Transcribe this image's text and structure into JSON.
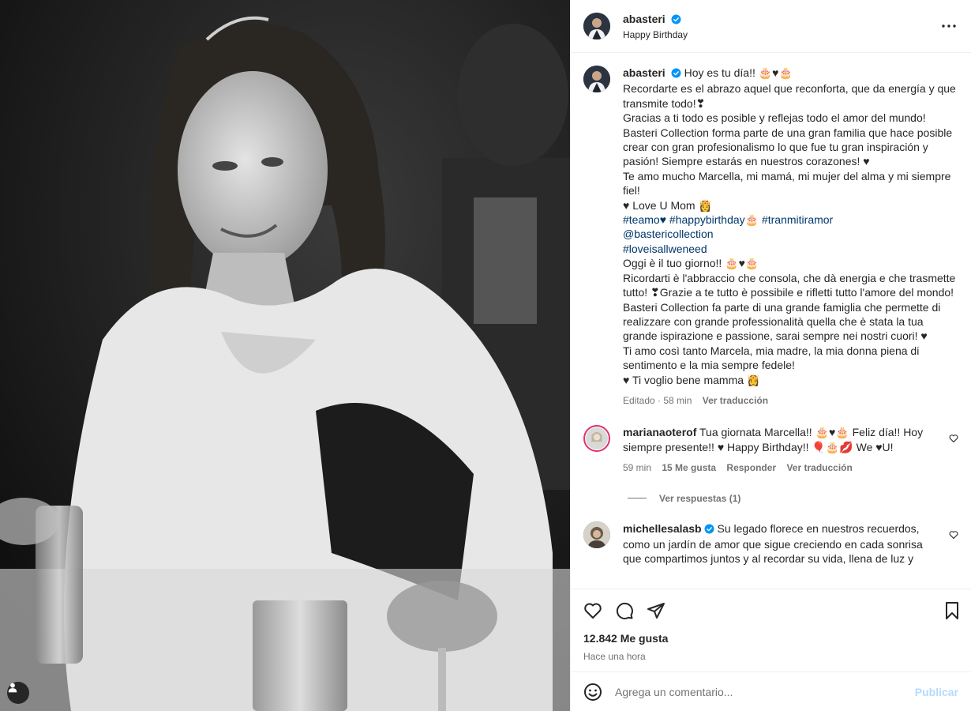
{
  "post": {
    "username": "abasteri",
    "subtitle": "Happy Birthday",
    "likes": "12.842 Me gusta",
    "time_ago": "Hace una hora"
  },
  "caption": {
    "username": "abasteri",
    "lines": [
      "Hoy es tu día!! 🎂♥🎂",
      "Recordarte es el abrazo aquel que reconforta, que da energía y que transmite todo!❣",
      "Gracias a ti todo es posible y reflejas todo el amor del mundo!",
      "Basteri Collection forma parte de una gran familia que hace posible crear con gran profesionalismo lo que fue tu gran inspiración y pasión! Siempre estarás en nuestros corazones! ♥",
      "Te amo mucho Marcella, mi mamá, mi mujer del alma y mi siempre fiel!",
      "♥ Love U Mom 👸"
    ],
    "hashtags_1": [
      "#teamo♥",
      "#happybirthday🎂",
      "#tranmitiramor"
    ],
    "mention": "@bastericollection",
    "hashtag_2": "#loveisallweneed",
    "lines_it": [
      "Oggi è il tuo giorno!! 🎂♥🎂",
      "Ricordarti è l'abbraccio che consola, che dà energia e che trasmette tutto! ❣Grazie a te tutto è possibile e rifletti tutto l'amore del mondo!",
      "Basteri Collection fa parte di una grande famiglia che permette di realizzare con grande professionalità quella che è stata la tua grande ispirazione e passione, sarai sempre nei nostri cuori! ♥",
      "Ti amo così tanto Marcela, mia madre, la mia donna piena di sentimento e la mia sempre fedele!",
      "♥ Ti voglio bene mamma 👸"
    ],
    "edited": "Editado · 58 min",
    "translate": "Ver traducción"
  },
  "comments": [
    {
      "username": "marianaoterof",
      "text": "Tua giornata Marcella!! 🎂♥🎂 Feliz día!! Hoy siempre presente!! ♥ Happy Birthday!! 🎈🎂💋 We ♥U!",
      "time": "59 min",
      "likes": "15 Me gusta",
      "reply": "Responder",
      "translate": "Ver traducción",
      "replies": "Ver respuestas (1)"
    },
    {
      "username": "michellesalasb",
      "text": "Su legado florece en nuestros recuerdos, como un jardín de amor que sigue creciendo en cada sonrisa que compartimos juntos y al recordar su vida, llena de luz y"
    }
  ],
  "composer": {
    "placeholder": "Agrega un comentario...",
    "post_label": "Publicar"
  },
  "icons": {
    "more": "more-options-icon",
    "like": "heart-icon",
    "comment": "comment-icon",
    "share": "share-icon",
    "save": "bookmark-icon",
    "emoji": "emoji-icon",
    "tag": "user-tag-icon"
  },
  "colors": {
    "verified": "#0095f6",
    "link": "#00376b",
    "secondary": "#737373",
    "publish_disabled": "#b3dbff"
  }
}
